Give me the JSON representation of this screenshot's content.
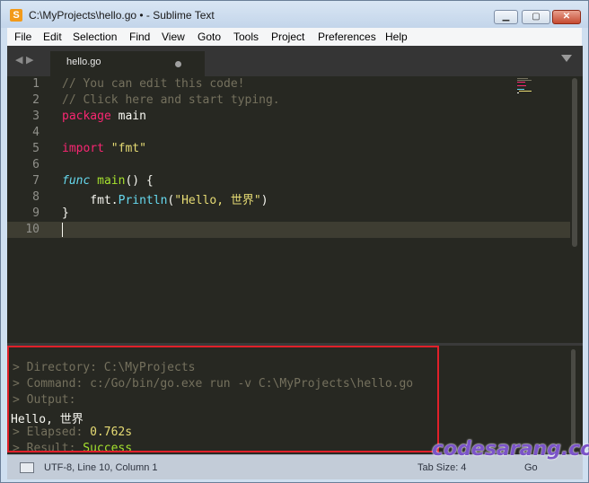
{
  "window": {
    "title": "C:\\MyProjects\\hello.go • - Sublime Text",
    "app_icon": "S",
    "controls": {
      "minimize": "▁",
      "maximize": "▢",
      "close": "✕"
    }
  },
  "menu": [
    "File",
    "Edit",
    "Selection",
    "Find",
    "View",
    "Goto",
    "Tools",
    "Project",
    "Preferences",
    "Help"
  ],
  "tabs": {
    "nav_left": "◀",
    "nav_right": "▶",
    "active": {
      "label": "hello.go",
      "dirty": true
    }
  },
  "editor": {
    "line_numbers": [
      "1",
      "2",
      "3",
      "4",
      "5",
      "6",
      "7",
      "8",
      "9",
      "10"
    ],
    "lines": {
      "l1": "// You can edit this code!",
      "l2": "// Click here and start typing.",
      "l3_kw": "package",
      "l3_rest": " main",
      "l5_kw": "import",
      "l5_str": "\"fmt\"",
      "l7_kw": "func",
      "l7_fn": "main",
      "l7_rest": "() {",
      "l8_pkg": "    fmt.",
      "l8_call": "Println",
      "l8_open": "(",
      "l8_str": "\"Hello, 世界\"",
      "l8_close": ")",
      "l9": "}"
    },
    "current_line": 10
  },
  "output": {
    "directory": "> Directory: C:\\MyProjects",
    "command": "> Command: c:/Go/bin/go.exe run -v C:\\MyProjects\\hello.go",
    "output_label": "> Output:",
    "program_output": "Hello, 世界",
    "elapsed_label": "> Elapsed: ",
    "elapsed_value": "0.762s",
    "result_label": "> Result: ",
    "result_value": "Success"
  },
  "status": {
    "encoding_position": "UTF-8, Line 10, Column 1",
    "tab_size": "Tab Size: 4",
    "syntax": "Go"
  },
  "watermark": "codesarang.com",
  "colors": {
    "editor_bg": "#272822",
    "comment": "#75715e",
    "keyword": "#f92672",
    "string": "#e6db74",
    "function": "#a6e22e",
    "storage": "#66d9ef",
    "highlight_box": "#e0202a",
    "watermark": "#7b54c8"
  }
}
